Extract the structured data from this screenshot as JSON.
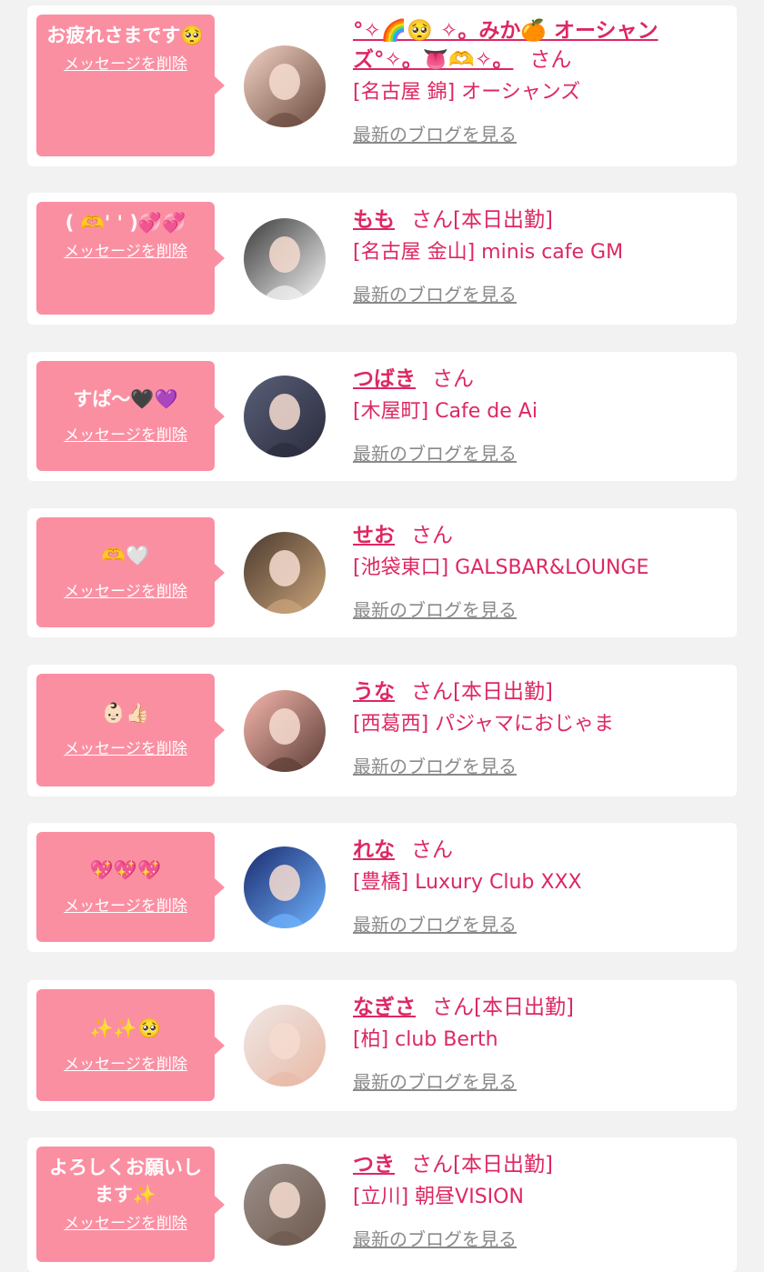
{
  "colors": {
    "background": "#f2f2f2",
    "card": "#ffffff",
    "bubble": "#fb8fa2",
    "accent": "#dd2862",
    "link_gray": "#8a8a8a"
  },
  "labels": {
    "delete_message": "メッセージを削除",
    "view_blog": "最新のブログを見る"
  },
  "items": [
    {
      "message": "お疲れさまです🥺",
      "name": "°✧🌈🥺 ✧。みか🍊 オーシャンズ°✧。👅🫶✧。",
      "suffix": "さん",
      "shop": "[名古屋 錦] オーシャンズ",
      "avatar_colors": [
        "#f3d2c6",
        "#6b4a3e"
      ]
    },
    {
      "message": "( 🫶' ' )💞💞",
      "name": "もも",
      "suffix": "さん[本日出勤]",
      "shop": "[名古屋 金山] minis cafe GM",
      "avatar_colors": [
        "#3a3a3a",
        "#f4f4f4"
      ]
    },
    {
      "message": "すぱ〜🖤💜",
      "name": "つばき",
      "suffix": "さん",
      "shop": "[木屋町] Cafe de Ai",
      "avatar_colors": [
        "#5a5f78",
        "#2a2c3c"
      ]
    },
    {
      "message": "🫶🤍",
      "name": "せお",
      "suffix": "さん",
      "shop": "[池袋東口] GALSBAR&LOUNGE",
      "avatar_colors": [
        "#4a3a2e",
        "#caa47a"
      ]
    },
    {
      "message": "👶🏻👍🏻",
      "name": "うな",
      "suffix": "さん[本日出勤]",
      "shop": "[西葛西] パジャマにおじゃま",
      "avatar_colors": [
        "#f6b7ad",
        "#5b3d35"
      ]
    },
    {
      "message": "💖💖💖",
      "name": "れな",
      "suffix": "さん",
      "shop": "[豊橋] Luxury Club XXX",
      "avatar_colors": [
        "#1b2b6e",
        "#6fb3ff"
      ]
    },
    {
      "message": "✨✨🥺",
      "name": "なぎさ",
      "suffix": "さん[本日出勤]",
      "shop": "[柏] club Berth",
      "avatar_colors": [
        "#efe7e4",
        "#e8b9a6"
      ]
    },
    {
      "message": "よろしくお願いします✨",
      "name": "つき",
      "suffix": "さん[本日出勤]",
      "shop": "[立川] 朝昼VISION",
      "avatar_colors": [
        "#9b8f8a",
        "#6e5a4e"
      ]
    }
  ]
}
